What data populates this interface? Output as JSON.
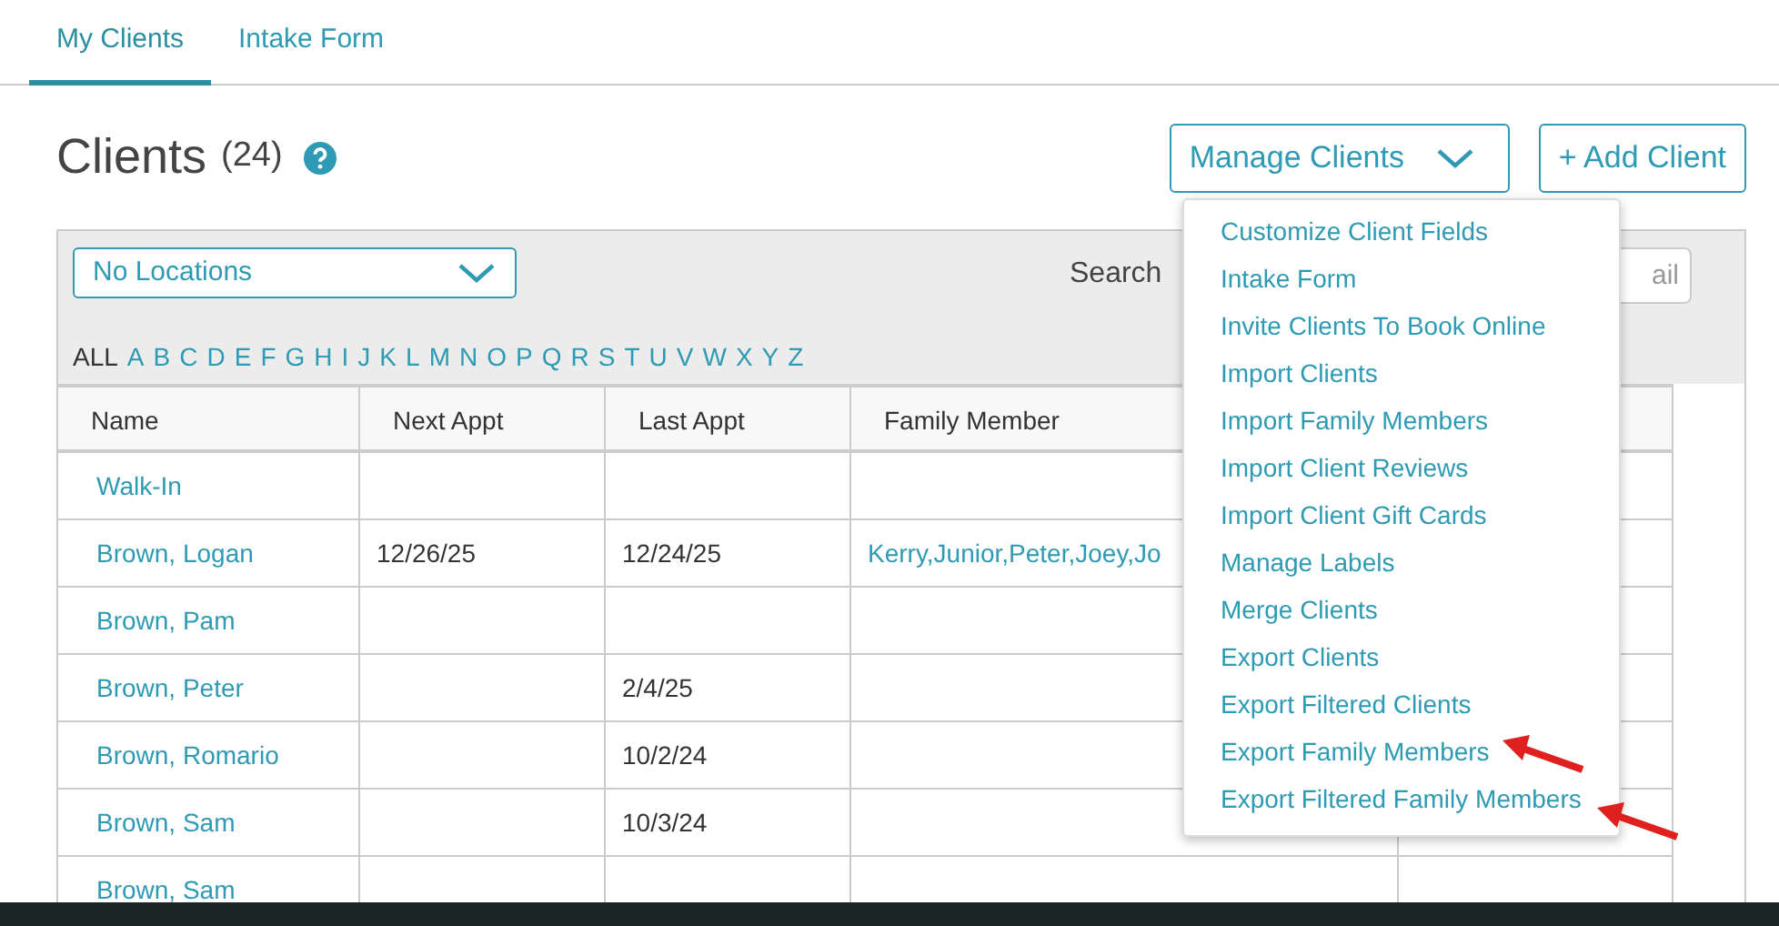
{
  "tabs": [
    {
      "label": "My Clients",
      "selected": true
    },
    {
      "label": "Intake Form",
      "selected": false
    }
  ],
  "header": {
    "title": "Clients",
    "count": "(24)"
  },
  "manage_button": {
    "label": "Manage Clients",
    "expanded": true
  },
  "add_button": {
    "label": "+ Add Client"
  },
  "location_select": {
    "value": "No Locations"
  },
  "search": {
    "label": "Search",
    "placeholder": "ail"
  },
  "letters": [
    {
      "label": "ALL",
      "selected": true
    },
    {
      "label": "A",
      "selected": false
    },
    {
      "label": "B",
      "selected": false
    },
    {
      "label": "C",
      "selected": false
    },
    {
      "label": "D",
      "selected": false
    },
    {
      "label": "E",
      "selected": false
    },
    {
      "label": "F",
      "selected": false
    },
    {
      "label": "G",
      "selected": false
    },
    {
      "label": "H",
      "selected": false
    },
    {
      "label": "I",
      "selected": false
    },
    {
      "label": "J",
      "selected": false
    },
    {
      "label": "K",
      "selected": false
    },
    {
      "label": "L",
      "selected": false
    },
    {
      "label": "M",
      "selected": false
    },
    {
      "label": "N",
      "selected": false
    },
    {
      "label": "O",
      "selected": false
    },
    {
      "label": "P",
      "selected": false
    },
    {
      "label": "Q",
      "selected": false
    },
    {
      "label": "R",
      "selected": false
    },
    {
      "label": "S",
      "selected": false
    },
    {
      "label": "T",
      "selected": false
    },
    {
      "label": "U",
      "selected": false
    },
    {
      "label": "V",
      "selected": false
    },
    {
      "label": "W",
      "selected": false
    },
    {
      "label": "X",
      "selected": false
    },
    {
      "label": "Y",
      "selected": false
    },
    {
      "label": "Z",
      "selected": false
    }
  ],
  "table": {
    "columns": [
      "Name",
      "Next Appt",
      "Last Appt",
      "Family Member"
    ],
    "rows": [
      {
        "name": "Walk-In",
        "next_appt": "",
        "last_appt": "",
        "family_member": ""
      },
      {
        "name": "Brown, Logan",
        "next_appt": "12/26/25",
        "last_appt": "12/24/25",
        "family_member": "Kerry,Junior,Peter,Joey,Jo"
      },
      {
        "name": "Brown, Pam",
        "next_appt": "",
        "last_appt": "",
        "family_member": ""
      },
      {
        "name": "Brown, Peter",
        "next_appt": "",
        "last_appt": "2/4/25",
        "family_member": ""
      },
      {
        "name": "Brown, Romario",
        "next_appt": "",
        "last_appt": "10/2/24",
        "family_member": ""
      },
      {
        "name": "Brown, Sam",
        "next_appt": "",
        "last_appt": "10/3/24",
        "family_member": ""
      },
      {
        "name": "Brown, Sam",
        "next_appt": "",
        "last_appt": "",
        "family_member": ""
      }
    ]
  },
  "menu": [
    "Customize Client Fields",
    "Intake Form",
    "Invite Clients To Book Online",
    "Import Clients",
    "Import Family Members",
    "Import Client Reviews",
    "Import Client Gift Cards",
    "Manage Labels",
    "Merge Clients",
    "Export Clients",
    "Export Filtered Clients",
    "Export Family Members",
    "Export Filtered Family Members"
  ]
}
